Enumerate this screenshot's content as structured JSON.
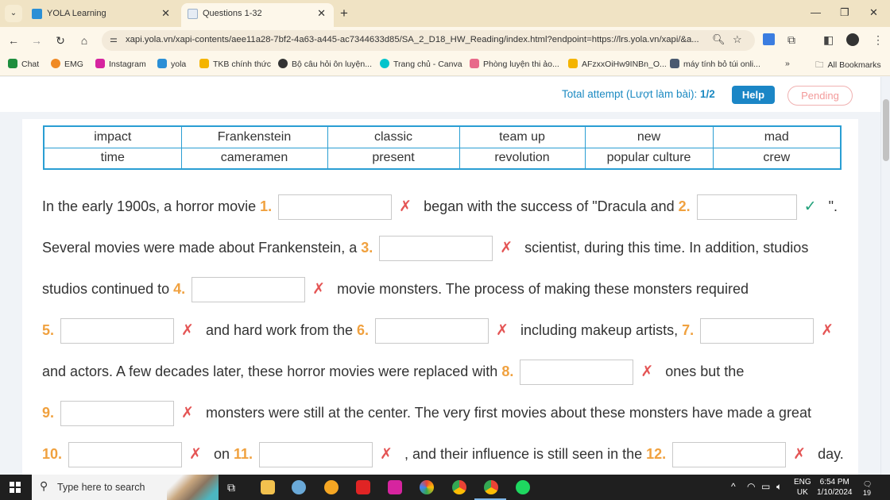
{
  "browser": {
    "tabs": [
      {
        "title": "YOLA Learning",
        "active": false
      },
      {
        "title": "Questions 1-32",
        "active": true
      }
    ],
    "url": "xapi.yola.vn/xapi-contents/aee11a28-7bf2-4a63-a445-ac7344633d85/SA_2_D18_HW_Reading/index.html?endpoint=https://lrs.yola.vn/xapi/&a...",
    "bookmarks": [
      {
        "label": "Chat",
        "color": "#1e8e3e"
      },
      {
        "label": "EMG",
        "color": "#f08a24"
      },
      {
        "label": "Instagram",
        "color": "#d6249f"
      },
      {
        "label": "yola",
        "color": "#2b8fd6"
      },
      {
        "label": "TKB chính thức",
        "color": "#f4b400"
      },
      {
        "label": "Bộ câu hỏi ôn luyện...",
        "color": "#333333"
      },
      {
        "label": "Trang chủ - Canva",
        "color": "#00c4cc"
      },
      {
        "label": "Phòng luyện thi ảo...",
        "color": "#e86a8a"
      },
      {
        "label": "AFzxxOiHw9INBn_O...",
        "color": "#f4b400"
      },
      {
        "label": "máy tính bỏ túi onli...",
        "color": "#4a5a70"
      }
    ],
    "bookmarks_overflow": "»",
    "all_bookmarks": "All Bookmarks"
  },
  "header": {
    "attempt_label": "Total attempt (Lượt làm bài): ",
    "attempt_value": "1/2",
    "help_label": "Help",
    "status_label": "Pending"
  },
  "word_bank": [
    [
      "impact",
      "Frankenstein",
      "classic",
      "team up",
      "new",
      "mad"
    ],
    [
      "time",
      "cameramen",
      "present",
      "revolution",
      "popular culture",
      "crew"
    ]
  ],
  "passage": {
    "l1": {
      "t0": "In the early 1900s, a horror movie ",
      "n1": "1.",
      "t1": " began with the success of \"Dracula and ",
      "n2": "2.",
      "t2": " \"."
    },
    "l2": {
      "t0": "Several movies were made about Frankenstein, a ",
      "n3": "3.",
      "t1": " scientist, during this time. In addition, studios"
    },
    "l3": {
      "t0": "studios continued to ",
      "n4": "4.",
      "t1": " movie monsters. The process of making these monsters required"
    },
    "l4": {
      "n5": "5.",
      "t1": " and hard work from the ",
      "n6": "6.",
      "t2": " including makeup artists, ",
      "n7": "7."
    },
    "l5": {
      "t0": "and actors. A few decades later, these horror movies were replaced with ",
      "n8": "8.",
      "t1": " ones but the"
    },
    "l6": {
      "n9": "9.",
      "t1": " monsters were still at the center. The very first movies about these monsters have made a great"
    },
    "l7": {
      "n10": "10.",
      "t1": " on ",
      "n11": "11.",
      "t2": " , and their influence is still seen in the ",
      "n12": "12.",
      "t3": " day."
    }
  },
  "answers": [
    {
      "number": 1,
      "value": "",
      "result": "wrong"
    },
    {
      "number": 2,
      "value": "",
      "result": "correct"
    },
    {
      "number": 3,
      "value": "",
      "result": "wrong"
    },
    {
      "number": 4,
      "value": "",
      "result": "wrong"
    },
    {
      "number": 5,
      "value": "",
      "result": "wrong"
    },
    {
      "number": 6,
      "value": "",
      "result": "wrong"
    },
    {
      "number": 7,
      "value": "",
      "result": "wrong"
    },
    {
      "number": 8,
      "value": "",
      "result": "wrong"
    },
    {
      "number": 9,
      "value": "",
      "result": "wrong"
    },
    {
      "number": 10,
      "value": "",
      "result": "wrong"
    },
    {
      "number": 11,
      "value": "",
      "result": "wrong"
    },
    {
      "number": 12,
      "value": "",
      "result": "wrong"
    }
  ],
  "marks": {
    "wrong": "✗",
    "correct": "✓"
  },
  "taskbar": {
    "search_placeholder": "Type here to search",
    "lang_top": "ENG",
    "lang_bottom": "UK",
    "time": "6:54 PM",
    "date": "1/10/2024",
    "notifications": "19"
  }
}
